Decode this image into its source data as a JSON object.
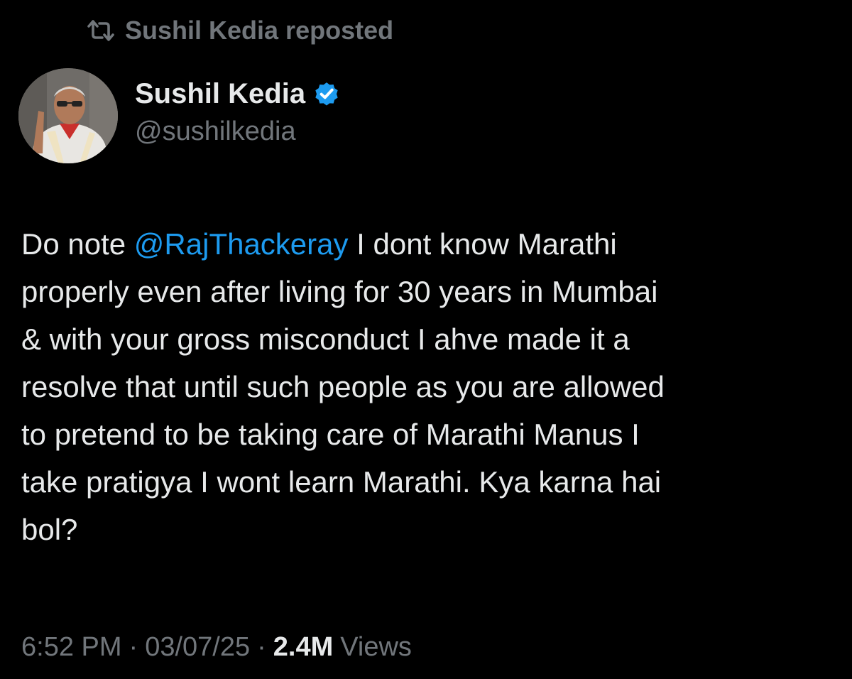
{
  "repost": {
    "icon": "repost-icon",
    "text": "Sushil Kedia reposted"
  },
  "author": {
    "name": "Sushil Kedia",
    "handle": "@sushilkedia",
    "verified_icon": "verified-badge-icon",
    "verified_color": "#1d9bf0"
  },
  "tweet": {
    "line1_before": "Do note ",
    "mention": "@RajThackeray",
    "line1_after": " I dont know Marathi",
    "line2": "properly even after living for 30 years in Mumbai",
    "line3": "& with your gross misconduct I ahve made it a",
    "line4": "resolve that until such people as you are allowed",
    "line5": "to pretend to be taking care of Marathi Manus I",
    "line6": "take pratigya I wont learn Marathi. Kya karna hai",
    "line7": "bol?"
  },
  "meta": {
    "time": "6:52 PM",
    "separator": "·",
    "date": "03/07/25",
    "views_count": "2.4M",
    "views_label": "Views"
  },
  "colors": {
    "background": "#000000",
    "text": "#e7e9ea",
    "secondary": "#71767b",
    "accent": "#1d9bf0"
  }
}
